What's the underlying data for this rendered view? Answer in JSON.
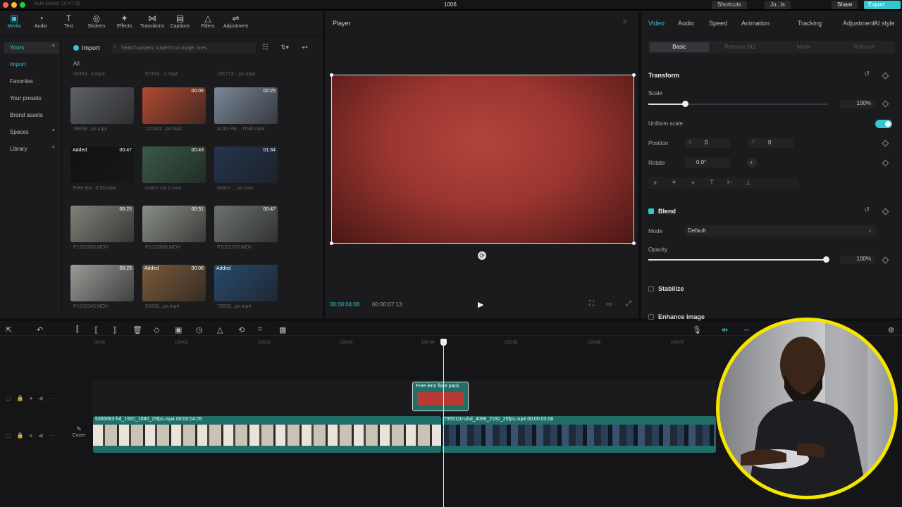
{
  "titlebar": {
    "autosave": "Auto saved: 10:47:38",
    "project": "1006",
    "shortcuts": "Shortcuts",
    "user": "Jo...ls",
    "share": "Share",
    "export": "Export"
  },
  "toolbar": [
    {
      "label": "Media",
      "icon": "media-icon"
    },
    {
      "label": "Audio",
      "icon": "audio-icon"
    },
    {
      "label": "Text",
      "icon": "text-icon"
    },
    {
      "label": "Stickers",
      "icon": "stickers-icon"
    },
    {
      "label": "Effects",
      "icon": "effects-icon"
    },
    {
      "label": "Transitions",
      "icon": "transitions-icon"
    },
    {
      "label": "Captions",
      "icon": "captions-icon"
    },
    {
      "label": "Filters",
      "icon": "filters-icon"
    },
    {
      "label": "Adjustment",
      "icon": "adjustment-icon"
    }
  ],
  "sidebar": {
    "items": [
      "Yours",
      "Import",
      "Favorites",
      "Your presets",
      "Brand assets",
      "Spaces",
      "Library"
    ]
  },
  "media": {
    "import_label": "Import",
    "search_placeholder": "Search project, subjects in image, lines",
    "all_label": "All",
    "top_captions": [
      "24353...e.mp4",
      "57303....s.mp4",
      "161773....ps.mp4"
    ],
    "grid": [
      {
        "dur": "",
        "added": "",
        "cap": "39608...ps.mp4",
        "color": "#5d6166"
      },
      {
        "dur": "00:06",
        "added": "",
        "cap": "121641...ps.mp4",
        "color": "#b04a32"
      },
      {
        "dur": "02:25",
        "added": "",
        "cap": "AUDI R8 ...TING.mp4",
        "color": "#7b8798"
      },
      {
        "dur": "00:47",
        "added": "Added",
        "cap": "Free len...0.05.mp4",
        "color": "#101112"
      },
      {
        "dur": "00:43",
        "added": "",
        "cap": "match cut 2.mov",
        "color": "#3a5a47"
      },
      {
        "dur": "01:34",
        "added": "",
        "cap": "Match ....ax.mov",
        "color": "#24354f"
      },
      {
        "dur": "00:25",
        "added": "",
        "cap": "P1022663.MOV",
        "color": "#7f8379"
      },
      {
        "dur": "00:51",
        "added": "",
        "cap": "P1022686.MOV",
        "color": "#8b8f88"
      },
      {
        "dur": "00:47",
        "added": "",
        "cap": "P1022703.MOV",
        "color": "#6d726e"
      },
      {
        "dur": "00:25",
        "added": "",
        "cap": "P1033143.MOV",
        "color": "#9a9c98"
      },
      {
        "dur": "00:08",
        "added": "Added",
        "cap": "53656...ps.mp4",
        "color": "#7a5a3c"
      },
      {
        "dur": "",
        "added": "Added",
        "cap": "79553...ps.mp4",
        "color": "#294a6e"
      }
    ]
  },
  "player": {
    "title": "Player",
    "current": "00:00:04:06",
    "total": "00:00:07:13"
  },
  "inspector": {
    "tabs": [
      "Video",
      "Audio",
      "Speed",
      "Animation",
      "Tracking",
      "Adjustment",
      "AI style"
    ],
    "subtabs": [
      "Basic",
      "Remove BG",
      "Mask",
      "Retouch"
    ],
    "transform": "Transform",
    "scale_label": "Scale",
    "scale_value": "100%",
    "uniform_label": "Uniform scale",
    "position_label": "Position",
    "pos_x_label": "X",
    "pos_x": "0",
    "pos_y_label": "Y",
    "pos_y": "0",
    "rotate_label": "Rotate",
    "rotate_value": "0.0°",
    "blend": "Blend",
    "mode_label": "Mode",
    "mode_value": "Default",
    "opacity_label": "Opacity",
    "opacity_value": "100%",
    "stabilize": "Stabilize",
    "enhance": "Enhance image"
  },
  "timeline": {
    "ticks": [
      "00:00",
      "100:01",
      "100:02",
      "100:03",
      "100:04",
      "100:05",
      "100:06",
      "100:07"
    ],
    "clip_overlay": "Free lens flare pack",
    "clip1": "5385663-hd_1920_1080_25fps.mp4  00:00:04:05",
    "clip2": "7955110-uhd_4096_2160_25fps.mp4  00:00:03:08",
    "cover": "Cover"
  },
  "colors": {
    "accent": "#35c7d0",
    "track": "#1f6f68",
    "overlay": "#b83a33"
  }
}
